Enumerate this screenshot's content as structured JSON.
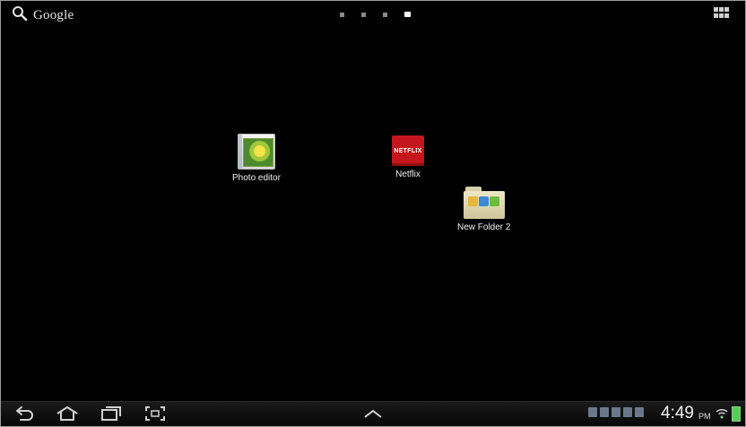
{
  "search": {
    "label": "Google",
    "icon": "search-icon"
  },
  "pages": {
    "count": 4,
    "active_index": 3
  },
  "apps_button": {
    "icon": "app-grid-icon"
  },
  "shortcuts": [
    {
      "label": "Photo editor",
      "icon": "photo-editor-icon"
    },
    {
      "label": "Netflix",
      "icon": "netflix-icon",
      "icon_text": "NETFLIX",
      "color": "#c4161c"
    },
    {
      "label": "New Folder 2",
      "icon": "folder-icon"
    }
  ],
  "navbar": {
    "buttons": [
      "back-icon",
      "home-icon",
      "recent-apps-icon",
      "screenshot-icon",
      "chevron-up-icon"
    ],
    "time": "4:49",
    "ampm": "PM"
  },
  "colors": {
    "background": "#000000",
    "accent_red": "#c4161c",
    "battery": "#55cc55"
  }
}
